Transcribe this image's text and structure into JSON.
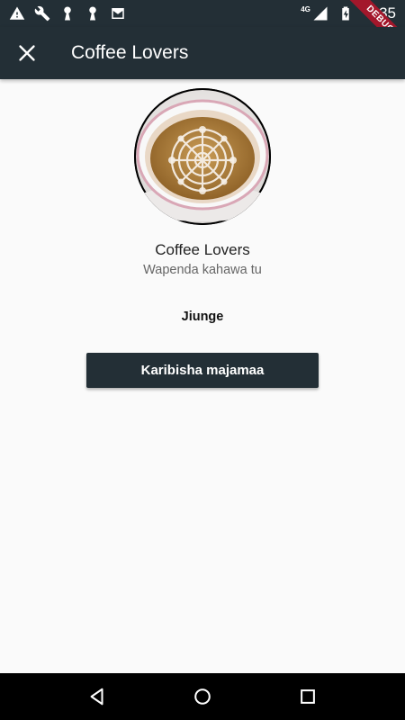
{
  "status_bar": {
    "time": "6:35",
    "network": "4G",
    "left_icons": [
      "warning-icon",
      "wrench-icon",
      "keyhole-icon",
      "keyhole-icon",
      "mail-icon"
    ],
    "right_icons": [
      "signal-icon",
      "battery-charging-icon"
    ]
  },
  "debug_banner": {
    "label": "DEBUG"
  },
  "app_bar": {
    "title": "Coffee Lovers",
    "close_icon": "close-icon"
  },
  "group": {
    "name": "Coffee Lovers",
    "description": "Wapenda kahawa tu",
    "avatar_alt": "coffee-cup-image"
  },
  "actions": {
    "join_label": "Jiunge",
    "invite_label": "Karibisha majamaa"
  },
  "nav_bar": {
    "back_icon": "back-triangle-icon",
    "home_icon": "home-circle-icon",
    "recents_icon": "recents-square-icon"
  },
  "colors": {
    "primary": "#232f36",
    "background": "#fafafa",
    "debug": "#a3172b"
  }
}
